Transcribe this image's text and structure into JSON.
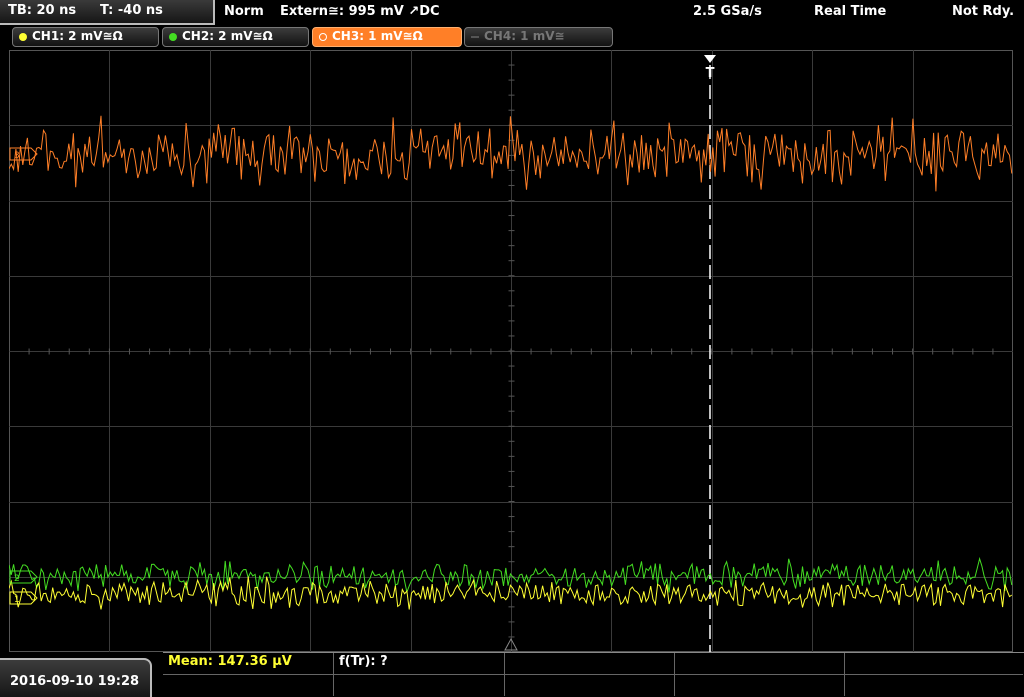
{
  "header": {
    "timebase": "TB: 20 ns",
    "trigger_offset": "T: -40 ns",
    "mode": "Norm",
    "trigger_source": "Extern≅: 995 mV ↗DC",
    "sample_rate": "2.5 GSa/s",
    "acq_mode": "Real Time",
    "status": "Not Rdy."
  },
  "channels": [
    {
      "label": "CH1: 2 mV≅Ω",
      "color": "#ffff33",
      "active": true
    },
    {
      "label": "CH2: 2 mV≅Ω",
      "color": "#44dd22",
      "active": true
    },
    {
      "label": "CH3: 1 mV≅Ω",
      "color": "#ff7f27",
      "active": true,
      "selected": true
    },
    {
      "label": "CH4: 1 mV≅",
      "color": "#666666",
      "active": false
    }
  ],
  "screen": {
    "trigger_marker": "T",
    "traces": [
      {
        "name": "CH3",
        "color": "#ff7f27"
      },
      {
        "name": "CH2",
        "color": "#44dd22"
      },
      {
        "name": "CH1",
        "color": "#ffff33"
      }
    ]
  },
  "footer": {
    "datetime": "2016-09-10 19:28",
    "measurement_1": "Mean: 147.36 µV",
    "measurement_2": "f(Tr): ?"
  }
}
